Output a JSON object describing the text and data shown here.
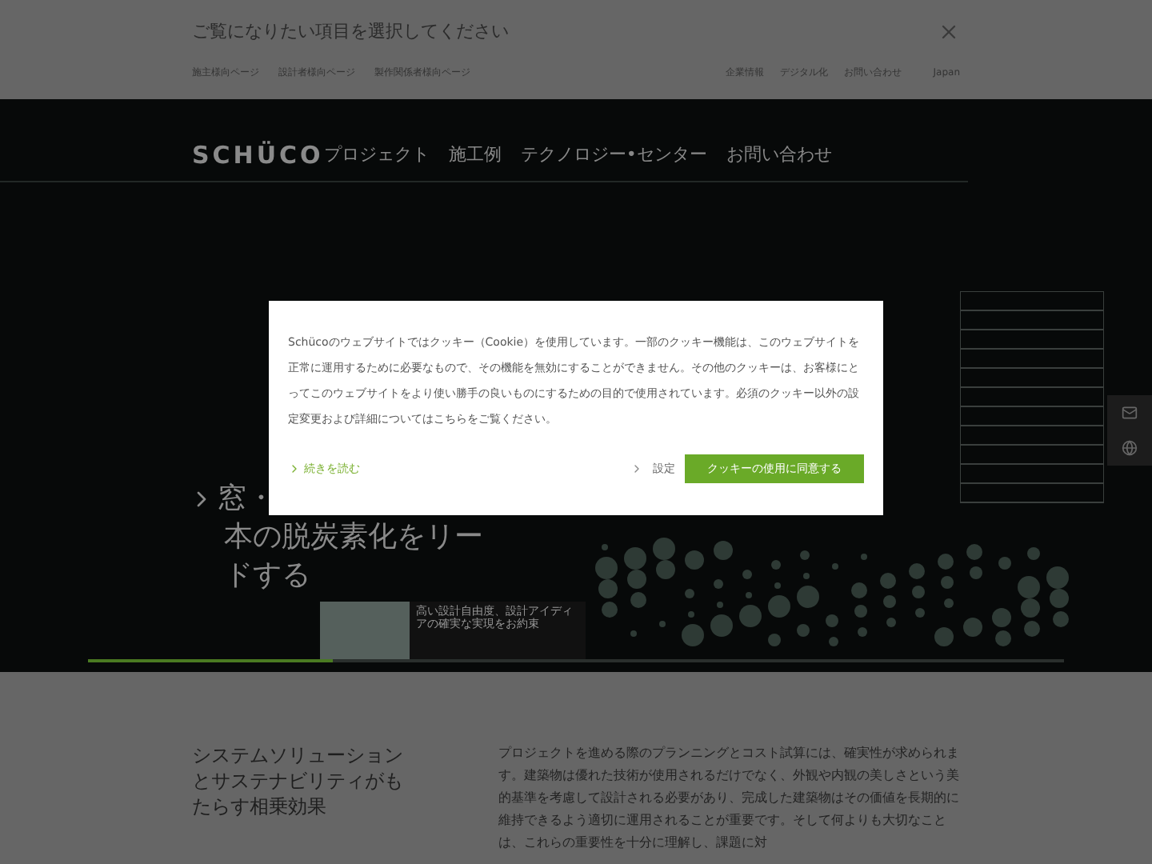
{
  "audience_bar": {
    "prompt": "ご覧になりたい項目を選択してください",
    "audience_links": [
      "施主様向ページ",
      "設計者様向ページ",
      "製作関係者様向ページ"
    ],
    "utility_links": [
      "企業情報",
      "デジタル化",
      "お問い合わせ"
    ],
    "country": "Japan"
  },
  "header": {
    "logo": "SCHÜCO",
    "nav": [
      "プロジェクト",
      "施工例",
      "テクノロジー•センター",
      "お問い合わせ"
    ]
  },
  "hero": {
    "title_lines": [
      "窓・",
      "本の脱炭素化をリー",
      "ドする"
    ],
    "teaser": "高い設計自由度、設計アイディアの確実な実現をお約束",
    "progress": {
      "level": 0.25
    }
  },
  "cookie_dialog": {
    "message": "Schücoのウェブサイトではクッキー（Cookie）を使用しています。一部のクッキー機能は、このウェブサイトを正常に運用するために必要なもので、その機能を無効にすることができません。その他のクッキーは、お客様にとってこのウェブサイトをより使い勝手の良いものにするための目的で使用されています。必須のクッキー以外の設定変更および詳細についてはこちらをご覧ください。",
    "read_more": "続きを読む",
    "settings": "設定",
    "accept": "クッキーの使用に同意する"
  },
  "intro": {
    "heading": "システムソリューションとサステナビリティがもたらす相乗効果",
    "body": "プロジェクトを進める際のプランニングとコスト試算には、確実性が求められます。建築物は優れた技術が使用されるだけでなく、外観や内観の美しさという美的基準を考慮して設計される必要があり、完成した建築物はその価値を長期的に維持できるよう適切に運用されることが重要です。そして何よりも大切なことは、これらの重要性を十分に理解し、課題に対"
  }
}
